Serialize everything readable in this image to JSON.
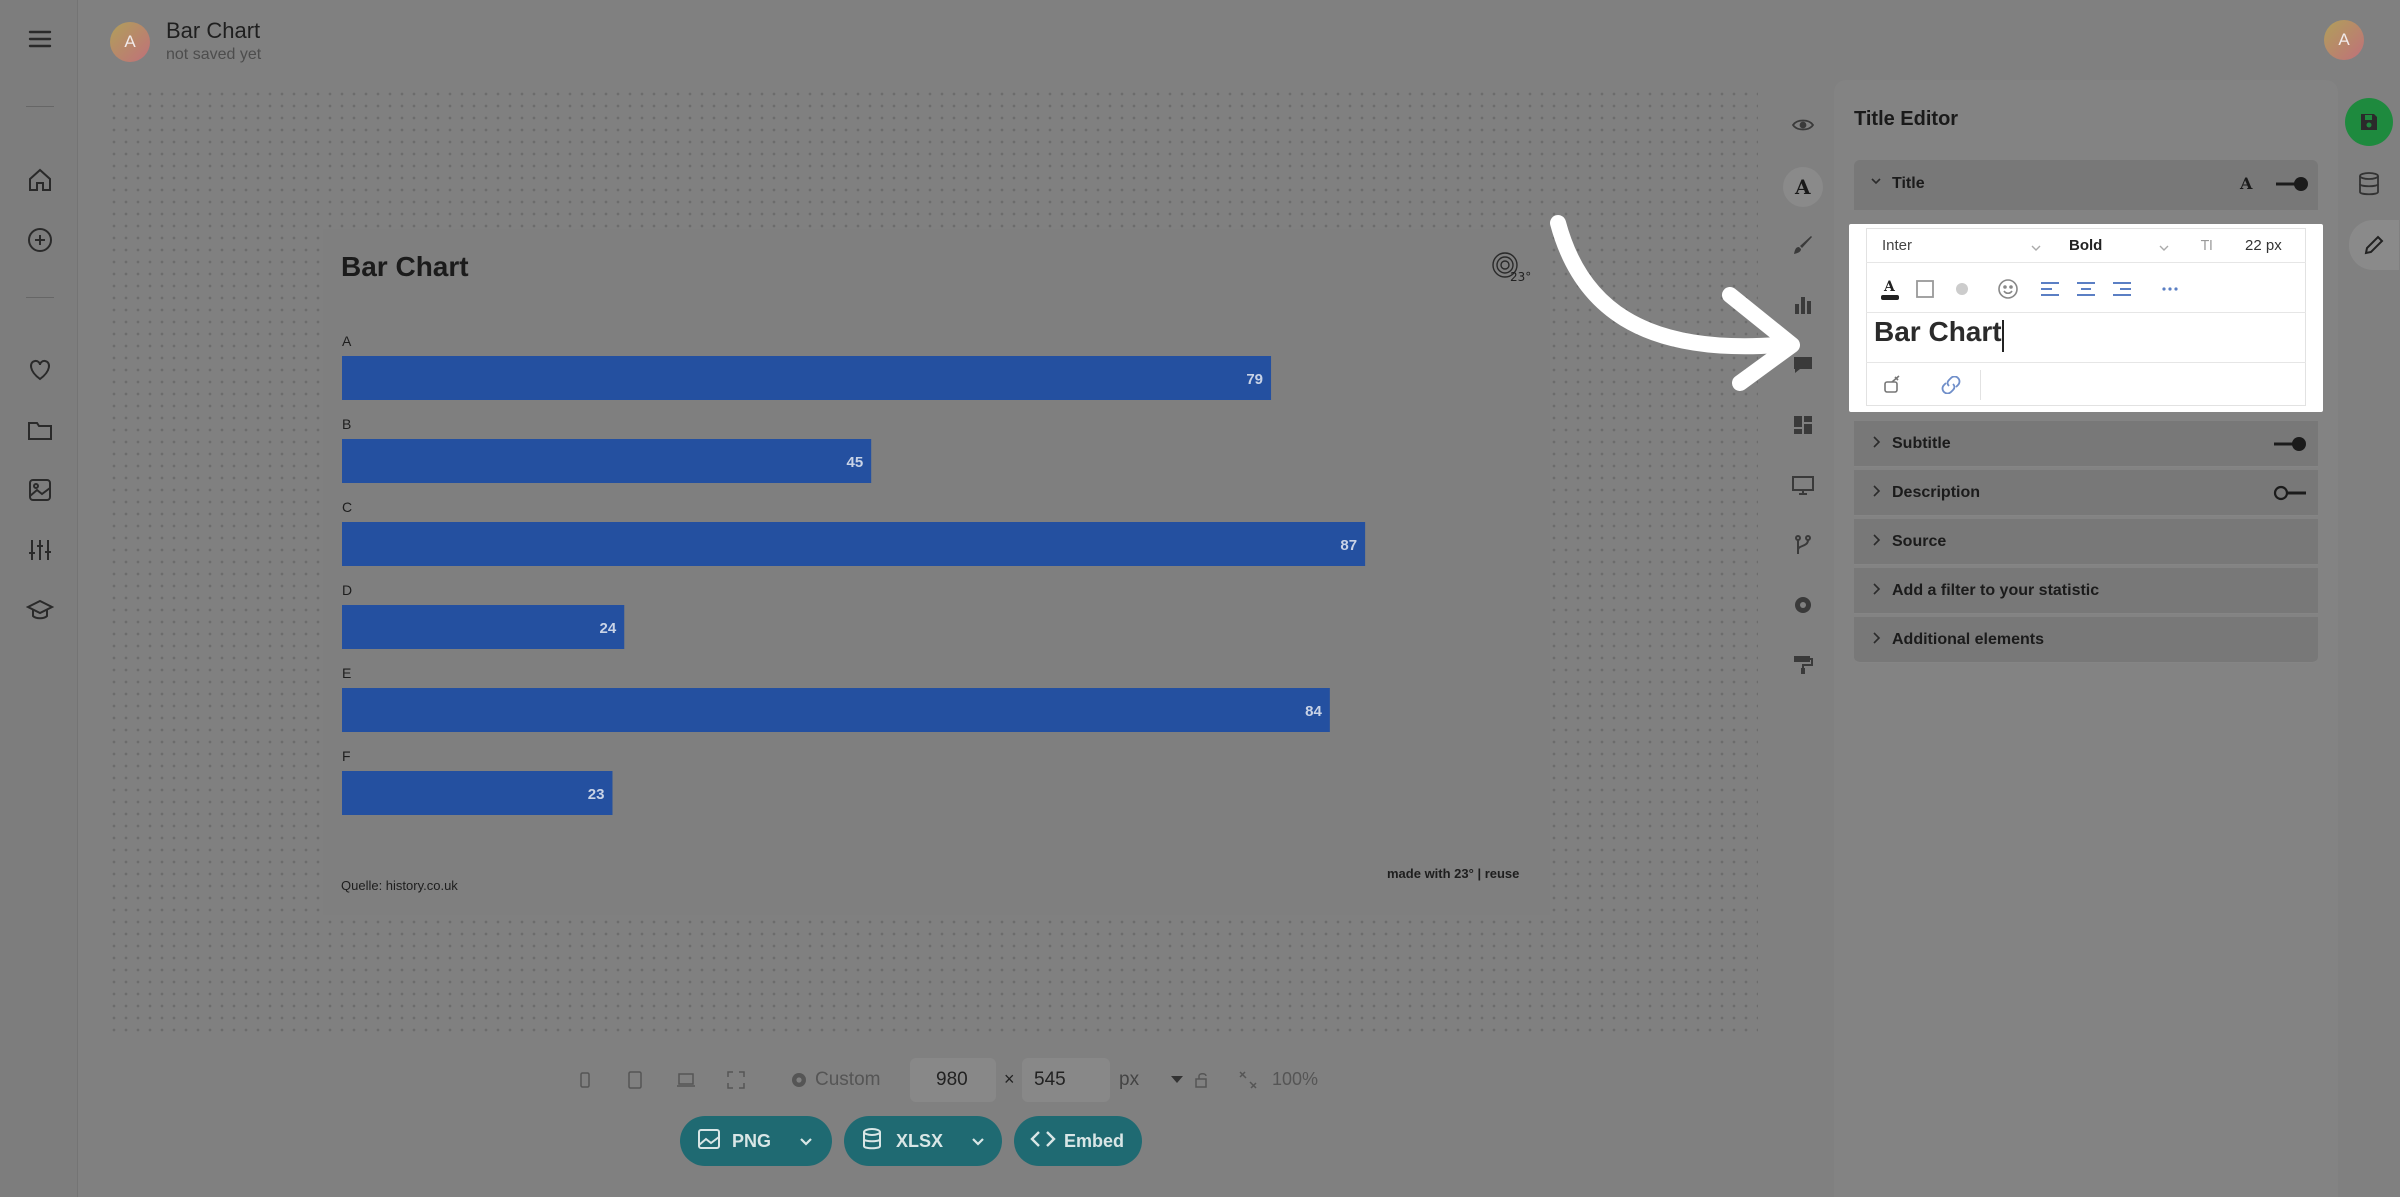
{
  "header": {
    "avatar_letter": "A",
    "doc_title": "Bar Chart",
    "doc_status": "not saved yet",
    "user_avatar_letter": "A"
  },
  "left_sidebar": {
    "icons": [
      "menu-icon",
      "home-icon",
      "add-icon",
      "heart-icon",
      "folder-icon",
      "image-icon",
      "sliders-icon",
      "graduation-cap-icon"
    ]
  },
  "chart": {
    "title": "Bar Chart",
    "source": "Quelle: history.co.uk",
    "credit": "made with 23° | reuse",
    "bar_color": "#2450a0"
  },
  "chart_data": {
    "type": "bar",
    "orientation": "horizontal",
    "title": "Bar Chart",
    "categories": [
      "A",
      "B",
      "C",
      "D",
      "E",
      "F"
    ],
    "values": [
      79,
      45,
      87,
      24,
      84,
      23
    ],
    "data_labels": true
  },
  "bottom_toolbar": {
    "preset_label": "Custom",
    "width": "980",
    "height": "545",
    "times": "×",
    "unit": "px",
    "zoom": "100%",
    "export_buttons": [
      {
        "label": "PNG"
      },
      {
        "label": "XLSX"
      },
      {
        "label": "Embed"
      }
    ]
  },
  "panel": {
    "title": "Title Editor",
    "title_section_label": "Title",
    "editor": {
      "font": "Inter",
      "weight": "Bold",
      "size": "22 px",
      "text": "Bar Chart"
    },
    "sections": [
      {
        "label": "Subtitle",
        "toggle": "on"
      },
      {
        "label": "Description",
        "toggle": "off"
      },
      {
        "label": "Source",
        "toggle": null
      },
      {
        "label": "Add a filter to your statistic",
        "toggle": null
      },
      {
        "label": "Additional elements",
        "toggle": null
      }
    ]
  },
  "colors": {
    "save_button": "#1e8a3e",
    "export_button": "#1f6a72"
  }
}
